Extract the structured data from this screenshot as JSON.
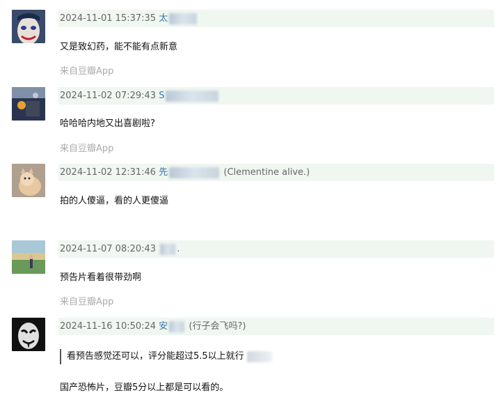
{
  "comments": [
    {
      "timestamp": "2024-11-01 15:37:35",
      "user_visible": "太",
      "text": "又是致幻药，能不能有点新意",
      "source": "来自豆瓣App"
    },
    {
      "timestamp": "2024-11-02 07:29:43",
      "user_visible": "S",
      "text": "哈哈哈内地又出喜剧啦?",
      "source": "来自豆瓣App"
    },
    {
      "timestamp": "2024-11-02 12:31:46",
      "user_visible": "先",
      "user_extra": "(Clementine alive.)",
      "text": "拍的人傻逼，看的人更傻逼"
    },
    {
      "timestamp": "2024-11-07 08:20:43",
      "user_visible": ".",
      "text": "预告片看着很带劲啊",
      "source": "来自豆瓣App"
    },
    {
      "timestamp": "2024-11-16 10:50:24",
      "user_visible": "安",
      "user_extra": "(行子会飞吗?)",
      "quote": "看预告感觉还可以，评分能超过5.5以上就行",
      "text": "国产恐怖片，豆瓣5分以上都是可以看的。"
    }
  ]
}
